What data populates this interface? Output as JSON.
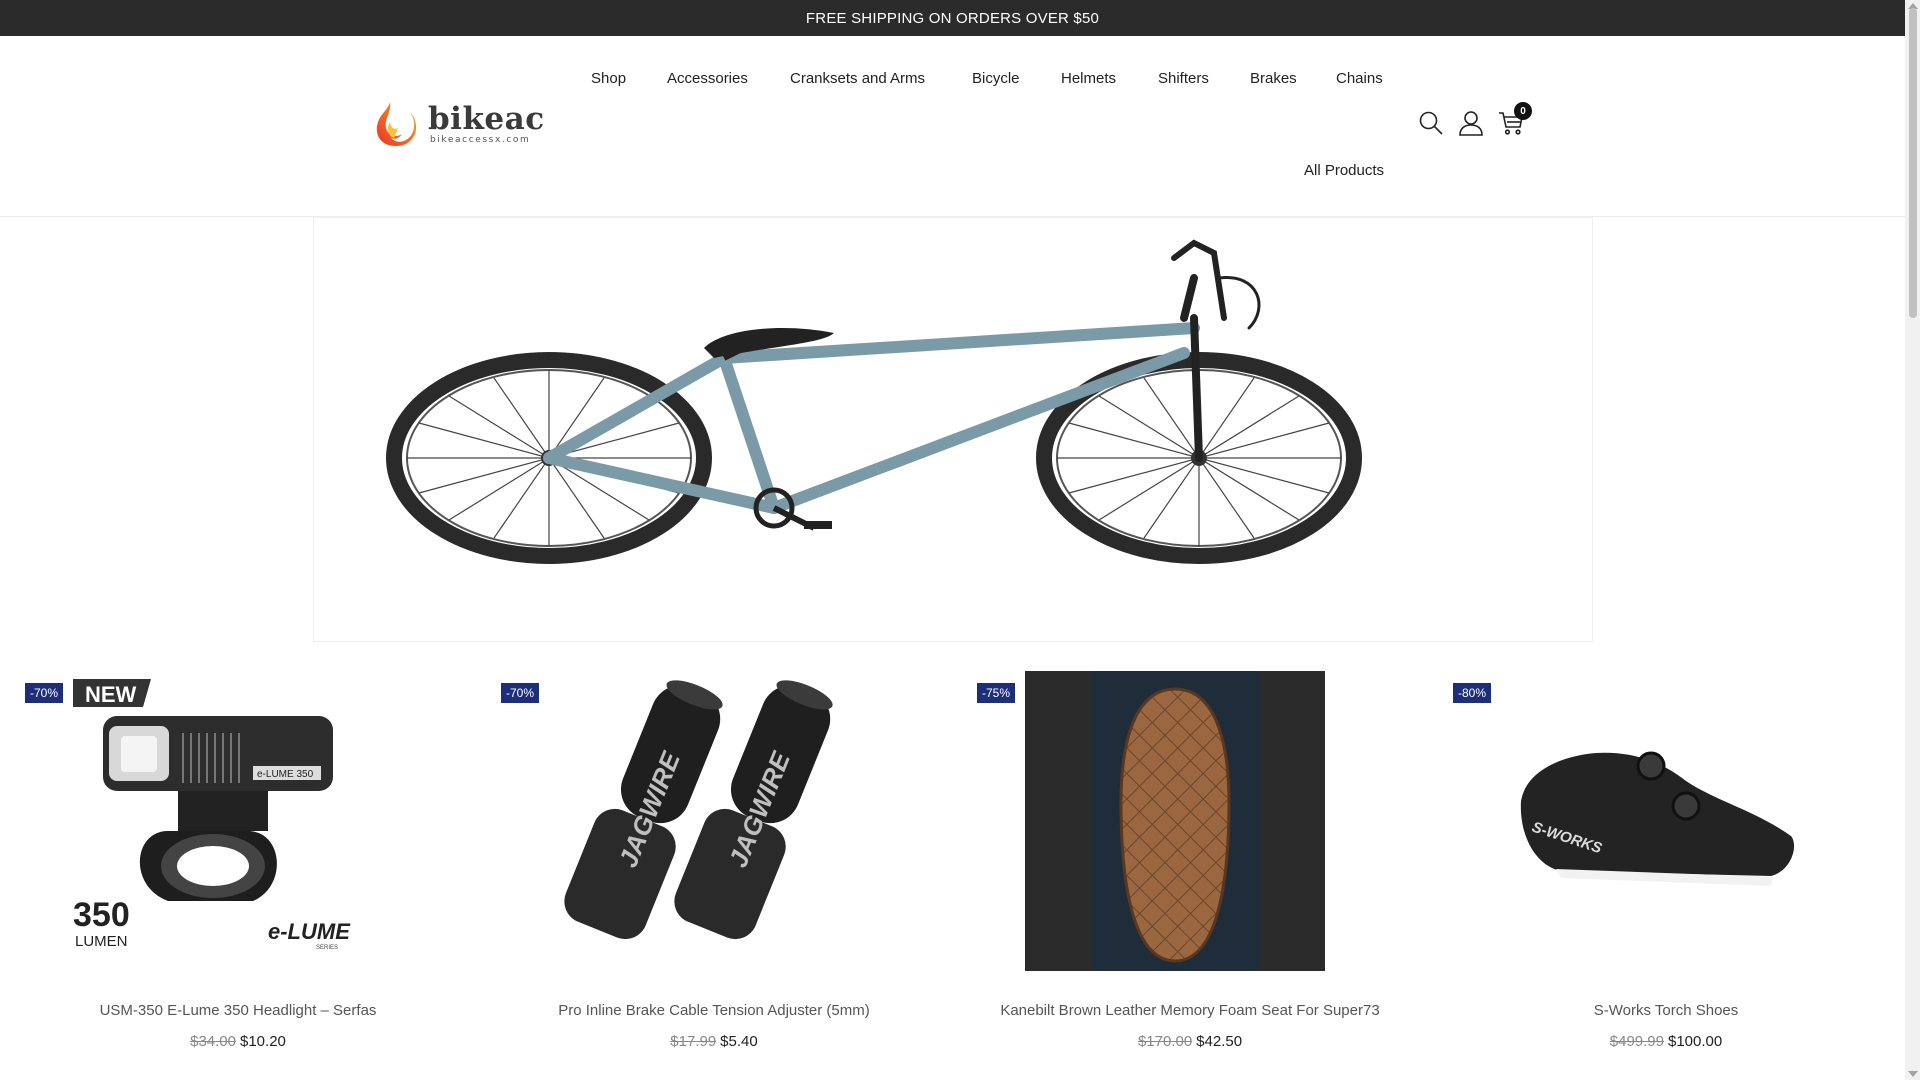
{
  "announcement": "FREE SHIPPING ON ORDERS OVER $50",
  "logo": {
    "word": "bikeac",
    "sub": "bikeaccessx.com"
  },
  "nav": {
    "items": [
      "Shop",
      "Accessories",
      "Cranksets and Arms",
      "Bicycle",
      "Helmets",
      "Shifters",
      "Brakes",
      "Chains"
    ],
    "all_products": "All Products"
  },
  "header_icons": {
    "search": "search-icon",
    "account": "user-icon",
    "cart": "cart-icon",
    "cart_count": "0"
  },
  "hero": {
    "image": "bicycle-banner-image"
  },
  "products": [
    {
      "badge": "-70%",
      "name": "USM-350 E-Lume 350 Headlight – Serfas",
      "old_price": "$34.00",
      "price": "$10.20",
      "image": "headlight-image",
      "tag": "NEW",
      "image_text": [
        "350",
        "LUMEN",
        "e-LUME",
        "SERIES",
        "e-LUME 350"
      ]
    },
    {
      "badge": "-70%",
      "name": "Pro Inline Brake Cable Tension Adjuster (5mm)",
      "old_price": "$17.99",
      "price": "$5.40",
      "image": "cable-adjuster-image",
      "image_text": [
        "JAGWIRE",
        "JAGWIRE"
      ]
    },
    {
      "badge": "-75%",
      "name": "Kanebilt Brown Leather Memory Foam Seat For Super73",
      "old_price": "$170.00",
      "price": "$42.50",
      "image": "leather-seat-image"
    },
    {
      "badge": "-80%",
      "name": "S-Works Torch Shoes",
      "old_price": "$499.99",
      "price": "$100.00",
      "image": "cycling-shoes-image",
      "image_text": [
        "S-WORKS"
      ]
    }
  ],
  "colors": {
    "topbar": "#2b2b2b",
    "badge": "#1d2f7a",
    "frame": "#7a9aa8",
    "logo_flame": "#f26a1b"
  }
}
